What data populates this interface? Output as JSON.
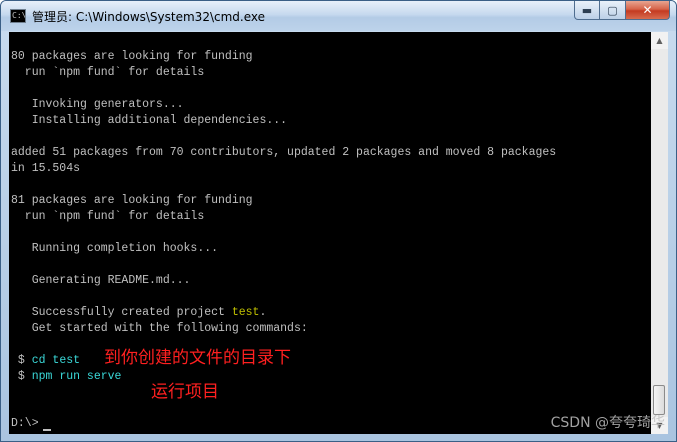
{
  "window": {
    "title": "管理员: C:\\Windows\\System32\\cmd.exe",
    "icon_text": "C:\\"
  },
  "caption_buttons": {
    "minimize": "▬",
    "maximize": "▢",
    "close": "✕"
  },
  "console": {
    "lines": [
      "80 packages are looking for funding",
      "  run `npm fund` for details",
      "",
      "   Invoking generators...",
      "   Installing additional dependencies...",
      "",
      "added 51 packages from 70 contributors, updated 2 packages and moved 8 packages",
      "in 15.504s",
      "",
      "81 packages are looking for funding",
      "  run `npm fund` for details",
      "",
      "   Running completion hooks...",
      "",
      "   Generating README.md...",
      "",
      "   Successfully created project "
    ],
    "project_name": "test",
    "project_suffix": ".",
    "get_started": "   Get started with the following commands:",
    "commands": [
      {
        "prompt": " $ ",
        "text": "cd test"
      },
      {
        "prompt": " $ ",
        "text": "npm run serve"
      }
    ],
    "final_prompt": "D:\\>"
  },
  "annotations": {
    "cd_note": "到你创建的文件的目录下",
    "serve_note": "运行项目"
  },
  "scrollbar": {
    "up_arrow": "▲",
    "down_arrow": "▼"
  },
  "watermark": "CSDN @夸夸琦华"
}
